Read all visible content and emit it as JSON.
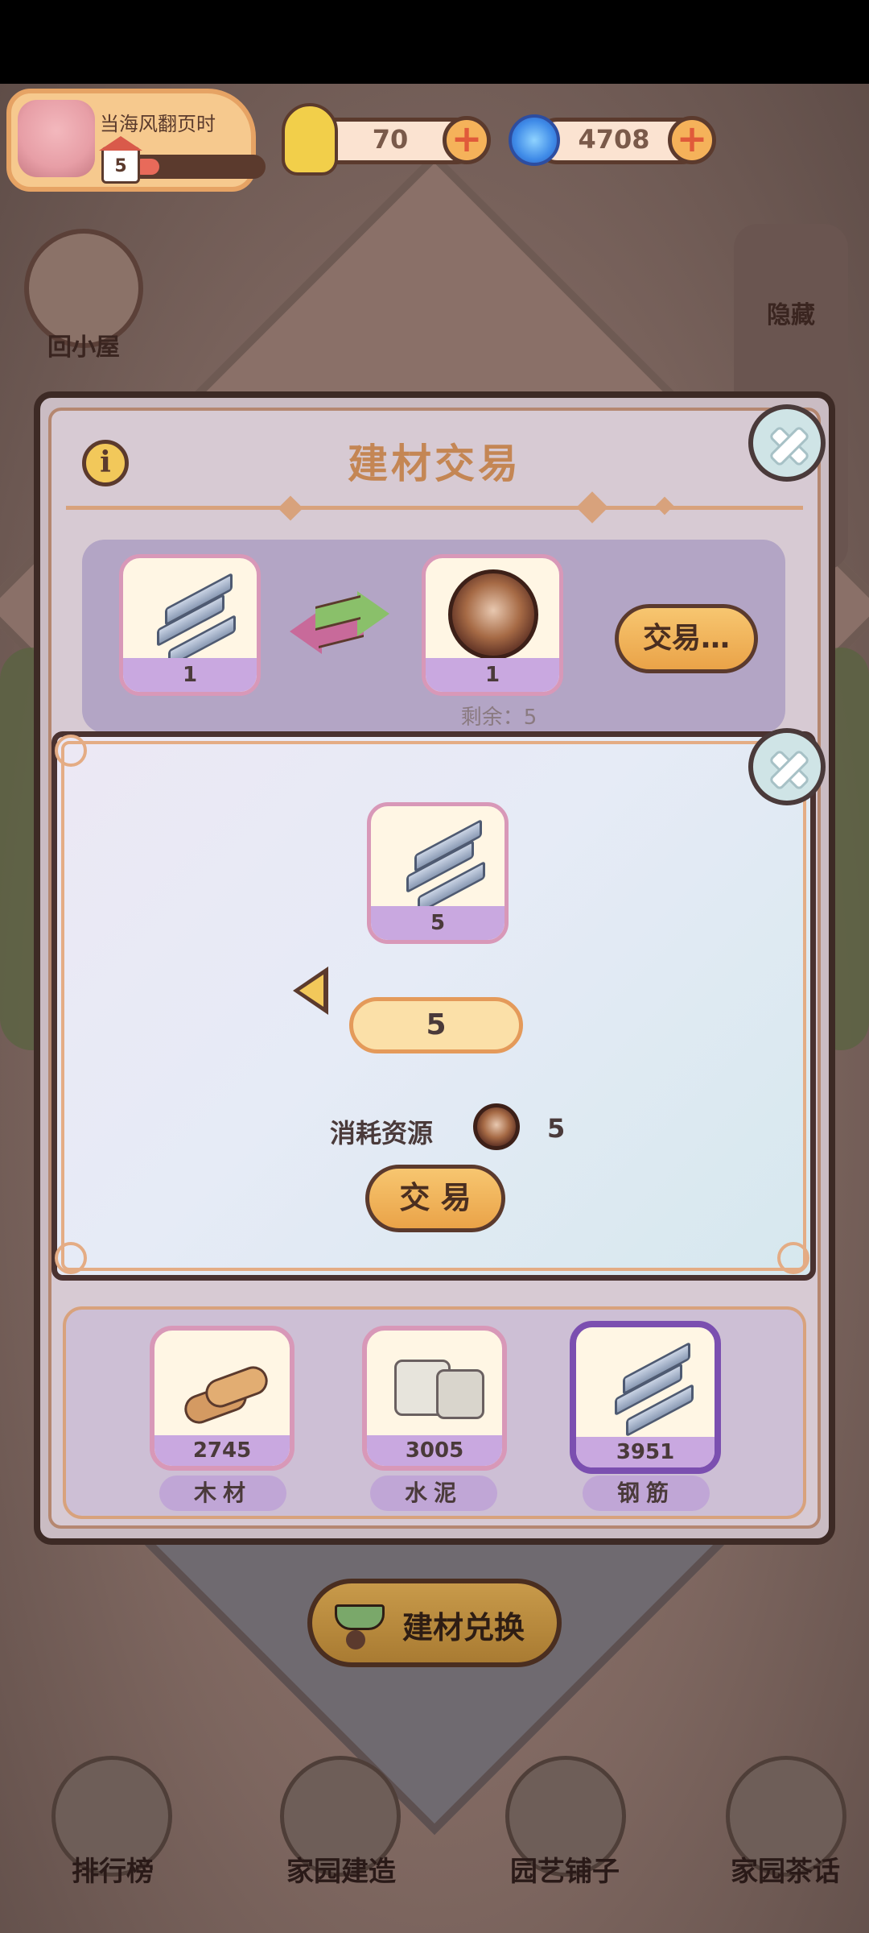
{
  "player": {
    "name": "当海风翻页时",
    "level": "5",
    "level_progress": 0.2
  },
  "currencies": [
    {
      "name": "snail",
      "value": "70",
      "icon": "snail-icon"
    },
    {
      "name": "swirl",
      "value": "4708",
      "icon": "swirl-icon"
    }
  ],
  "side": {
    "home_label": "回小屋",
    "hide_label": "隐藏"
  },
  "panel": {
    "title": "建材交易",
    "trade": {
      "give_count": "1",
      "get_count": "1",
      "button_label": "交易…",
      "remaining": "剩余：5"
    },
    "materials": [
      {
        "label": "木材",
        "count": "2745",
        "icon": "wood-icon"
      },
      {
        "label": "水泥",
        "count": "3005",
        "icon": "cement-icon"
      },
      {
        "label": "钢筋",
        "count": "3951",
        "icon": "rebar-icon",
        "selected": true
      }
    ]
  },
  "dialog": {
    "item_count": "5",
    "quantity": "5",
    "cost_label": "消耗资源",
    "cost_value": "5",
    "trade_label": "交 易"
  },
  "exchange_button": "建材兑换",
  "nav": [
    {
      "label": "排行榜",
      "icon": "leaderboard-icon"
    },
    {
      "label": "家园建造",
      "icon": "build-icon"
    },
    {
      "label": "园艺铺子",
      "icon": "garden-shop-icon"
    },
    {
      "label": "家园茶话",
      "icon": "chat-icon"
    }
  ],
  "colors": {
    "accent": "#f5b25a",
    "title": "#c48654",
    "selected": "#7b4fb0"
  }
}
